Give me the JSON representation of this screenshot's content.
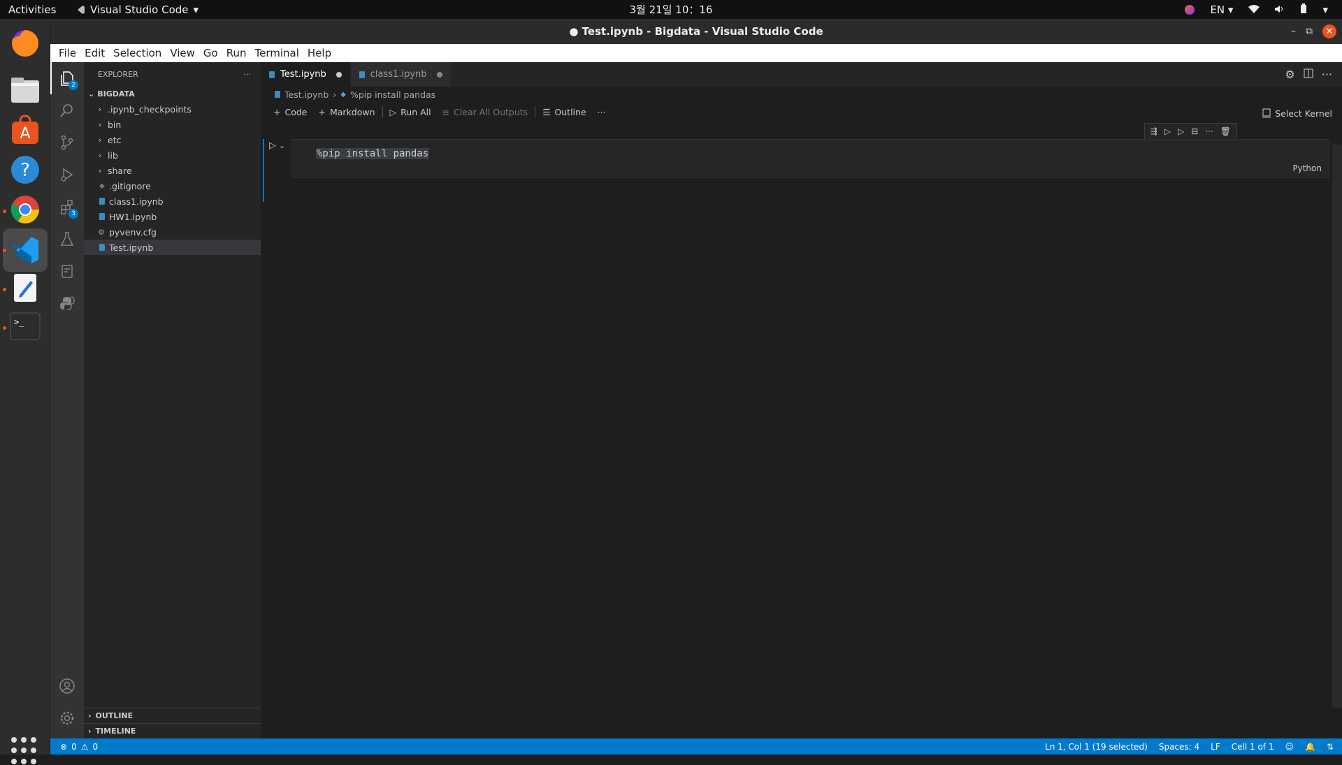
{
  "topbar": {
    "activities": "Activities",
    "app_name": "Visual Studio Code",
    "clock": "3월 21일  10：16",
    "lang": "EN"
  },
  "window": {
    "title": "● Test.ipynb - Bigdata - Visual Studio Code"
  },
  "menu": {
    "items": [
      "File",
      "Edit",
      "Selection",
      "View",
      "Go",
      "Run",
      "Terminal",
      "Help"
    ]
  },
  "activitybar": {
    "explorer_badge": "2",
    "extensions_badge": "3"
  },
  "explorer": {
    "header": "EXPLORER",
    "more": "···",
    "root": "BIGDATA",
    "items": [
      {
        "name": ".ipynb_checkpoints",
        "type": "folder"
      },
      {
        "name": "bin",
        "type": "folder"
      },
      {
        "name": "etc",
        "type": "folder"
      },
      {
        "name": "lib",
        "type": "folder"
      },
      {
        "name": "share",
        "type": "folder"
      },
      {
        "name": ".gitignore",
        "type": "file"
      },
      {
        "name": "class1.ipynb",
        "type": "notebook"
      },
      {
        "name": "HW1.ipynb",
        "type": "notebook"
      },
      {
        "name": "pyvenv.cfg",
        "type": "config"
      },
      {
        "name": "Test.ipynb",
        "type": "notebook"
      }
    ],
    "outline": "OUTLINE",
    "timeline": "TIMELINE"
  },
  "tabs": [
    {
      "label": "Test.ipynb",
      "dirty": true,
      "active": true
    },
    {
      "label": "class1.ipynb",
      "dirty": true,
      "active": false
    }
  ],
  "breadcrumb": {
    "file": "Test.ipynb",
    "cell": "%pip install pandas"
  },
  "toolbar": {
    "code": "Code",
    "markdown": "Markdown",
    "run_all": "Run All",
    "clear_outputs": "Clear All Outputs",
    "outline": "Outline",
    "more": "···",
    "select_kernel": "Select Kernel"
  },
  "cell": {
    "source": "%pip install pandas",
    "language": "Python"
  },
  "statusbar": {
    "errors": "0",
    "warnings": "0",
    "position": "Ln 1, Col 1 (19 selected)",
    "spaces": "Spaces: 4",
    "eol": "LF",
    "cell": "Cell 1 of 1"
  },
  "colors": {
    "accent": "#007acc",
    "ubuntu_orange": "#e95420"
  }
}
